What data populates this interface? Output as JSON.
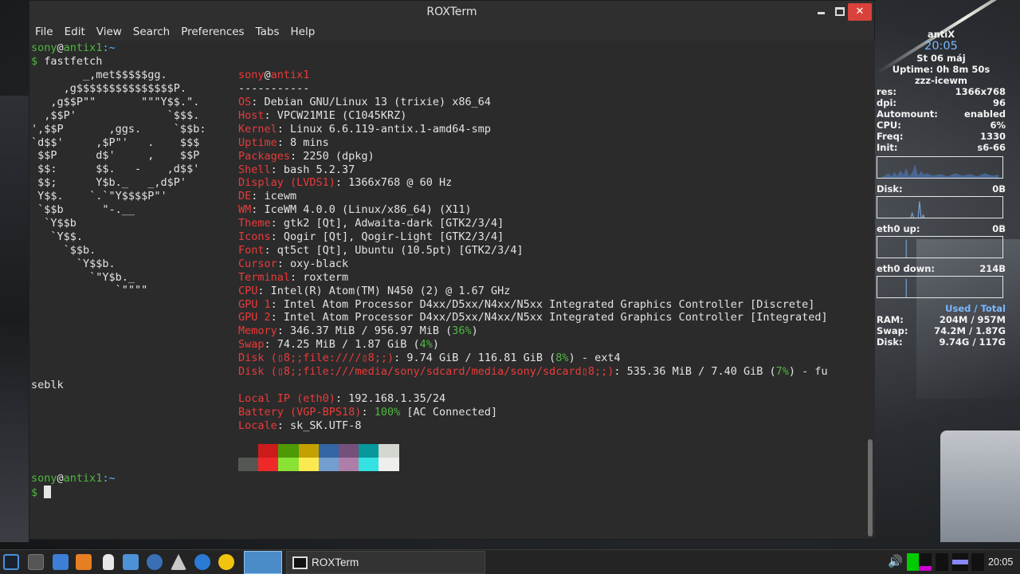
{
  "window": {
    "title": "ROXTerm",
    "min_label": "",
    "close_label": "✕",
    "menu": [
      "File",
      "Edit",
      "View",
      "Search",
      "Preferences",
      "Tabs",
      "Help"
    ]
  },
  "terminal": {
    "prompt1_user": "sony",
    "prompt1_host": "antix1",
    "prompt1_path": ":~",
    "command": "fastfetch",
    "logo": [
      "        _,met$$$$$gg.",
      "     ,g$$$$$$$$$$$$$$$P.",
      "   ,g$$P\"\"       \"\"\"Y$$.\".",
      "  ,$$P'              `$$$.",
      "',$$P       ,ggs.     `$$b:",
      "`d$$'     ,$P\"'   .    $$$",
      " $$P      d$'     ,    $$P",
      " $$:      $$.   -    ,d$$'",
      " $$;      Y$b._   _,d$P'",
      " Y$$.    `.`\"Y$$$$P\"'",
      " `$$b      \"-.__",
      "  `Y$$b",
      "   `Y$$.",
      "     `$$b.",
      "       `Y$$b.",
      "         `\"Y$b._",
      "             `\"\"\"\""
    ],
    "info_user": "sony",
    "info_at": "@",
    "info_host": "antix1",
    "separator": "-----------",
    "info": [
      {
        "key": "OS",
        "value": ": Debian GNU/Linux 13 (trixie) x86_64"
      },
      {
        "key": "Host",
        "value": ": VPCW21M1E (C1045KRZ)"
      },
      {
        "key": "Kernel",
        "value": ": Linux 6.6.119-antix.1-amd64-smp"
      },
      {
        "key": "Uptime",
        "value": ": 8 mins"
      },
      {
        "key": "Packages",
        "value": ": 2250 (dpkg)"
      },
      {
        "key": "Shell",
        "value": ": bash 5.2.37"
      },
      {
        "key": "Display (LVDS1)",
        "value": ": 1366x768 @ 60 Hz"
      },
      {
        "key": "DE",
        "value": ": icewm"
      },
      {
        "key": "WM",
        "value": ": IceWM 4.0.0 (Linux/x86_64) (X11)"
      },
      {
        "key": "Theme",
        "value": ": gtk2 [Qt], Adwaita-dark [GTK2/3/4]"
      },
      {
        "key": "Icons",
        "value": ": Qogir [Qt], Qogir-Light [GTK2/3/4]"
      },
      {
        "key": "Font",
        "value": ": qt5ct [Qt], Ubuntu (10.5pt) [GTK2/3/4]"
      },
      {
        "key": "Cursor",
        "value": ": oxy-black"
      },
      {
        "key": "Terminal",
        "value": ": roxterm"
      },
      {
        "key": "CPU",
        "value": ": Intel(R) Atom(TM) N450 (2) @ 1.67 GHz"
      },
      {
        "key": "GPU 1",
        "value": ": Intel Atom Processor D4xx/D5xx/N4xx/N5xx Integrated Graphics Controller [Discrete]"
      },
      {
        "key": "GPU 2",
        "value": ": Intel Atom Processor D4xx/D5xx/N4xx/N5xx Integrated Graphics Controller [Integrated]"
      }
    ],
    "memory_key": "Memory",
    "memory_val": ": 346.37 MiB / 956.97 MiB (",
    "memory_pct": "36%",
    "swap_key": "Swap",
    "swap_val": ": 74.25 MiB / 1.87 GiB (",
    "swap_pct": "4%",
    "disk1_key": "Disk (",
    "disk1_esc": "▯8;;file:////▯8;;)",
    "disk1_val": ": 9.74 GiB / 116.81 GiB (",
    "disk1_pct": "8%",
    "disk1_tail": ") - ext4",
    "disk2_key": "Disk (",
    "disk2_esc": "▯8;;file:///media/sony/sdcard/media/sony/sdcard▯8;;)",
    "disk2_val": ": 535.36 MiB / 7.40 GiB (",
    "disk2_pct": "7%",
    "disk2_tail": ") - fu",
    "wrap_tail": "seblk",
    "ip_key": "Local IP (eth0)",
    "ip_val": ": 192.168.1.35/24",
    "battery_key": "Battery (VGP-BPS18)",
    "battery_sep": ": ",
    "battery_pct": "100%",
    "battery_tail": " [AC Connected]",
    "locale_key": "Locale",
    "locale_val": ": sk_SK.UTF-8",
    "palette": [
      "#2b2b2b",
      "#cc1b1b",
      "#4e9a06",
      "#c4a000",
      "#3465a4",
      "#75507b",
      "#06989a",
      "#d3d7cf",
      "#555753",
      "#ef2929",
      "#8ae234",
      "#fce94f",
      "#729fcf",
      "#ad7fa8",
      "#34e2e2",
      "#eeeeec"
    ],
    "prompt2_user": "sony",
    "prompt2_host": "antix1",
    "prompt2_path": ":~",
    "prompt_symbol": "$"
  },
  "conky": {
    "hostname": "antiX",
    "time": "20:05",
    "date": "St 06 máj",
    "uptime": "Uptime: 0h 8m 50s",
    "theme": "zzz-icewm",
    "rows": [
      {
        "label": "res:",
        "value": "1366x768"
      },
      {
        "label": "dpi:",
        "value": "96"
      },
      {
        "label": "Automount:",
        "value": "enabled"
      },
      {
        "label": "CPU:",
        "value": "6%"
      },
      {
        "label": "Freq:",
        "value": "1330"
      },
      {
        "label": "Init:",
        "value": "s6-66"
      }
    ],
    "disk_label": "Disk:",
    "disk_value": "0B",
    "eth_up_label": "eth0 up:",
    "eth_up_value": "0B",
    "eth_down_label": "eth0 down:",
    "eth_down_value": "214B",
    "usage_header": "Used / Total",
    "usage": [
      {
        "label": "RAM:",
        "value": "204M  / 957M"
      },
      {
        "label": "Swap:",
        "value": "74.2M / 1.87G"
      },
      {
        "label": "Disk:",
        "value": "9.74G / 117G"
      }
    ]
  },
  "taskbar": {
    "task_label": "ROXTerm",
    "clock": "20:05",
    "volume_icon": "🔊"
  }
}
